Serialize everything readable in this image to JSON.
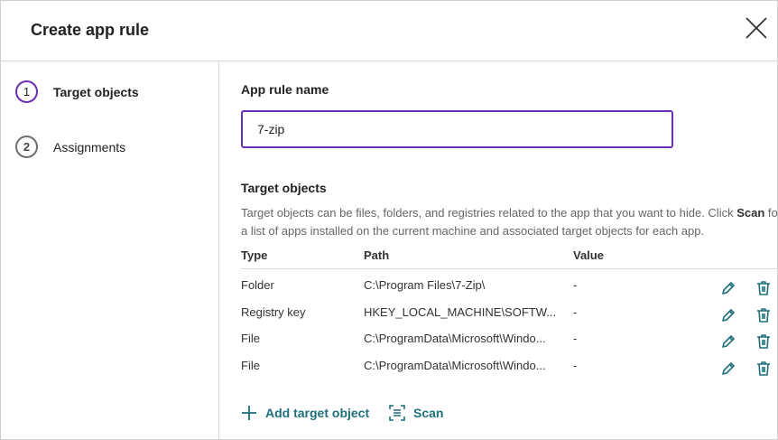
{
  "dialog": {
    "title": "Create app rule"
  },
  "steps": [
    {
      "number": "1",
      "label": "Target objects"
    },
    {
      "number": "2",
      "label": "Assignments"
    }
  ],
  "form": {
    "name_label": "App rule name",
    "name_value": "7-zip",
    "targets_label": "Target objects",
    "description_prefix": "Target objects can be files, folders, and registries related to the app that you want to hide. Click",
    "description_scan": "Scan",
    "description_suffix": "for a list of apps installed on the current machine and associated target objects for each app."
  },
  "table": {
    "columns": [
      "Type",
      "Path",
      "Value"
    ],
    "rows": [
      {
        "type": "Folder",
        "path": "C:\\Program Files\\7-Zip\\",
        "value": "-"
      },
      {
        "type": "Registry key",
        "path": "HKEY_LOCAL_MACHINE\\SOFTW...",
        "value": "-"
      },
      {
        "type": "File",
        "path": "C:\\ProgramData\\Microsoft\\Windo...",
        "value": "-"
      },
      {
        "type": "File",
        "path": "C:\\ProgramData\\Microsoft\\Windo...",
        "value": "-"
      }
    ]
  },
  "actions": {
    "add_label": "Add target object",
    "scan_label": "Scan"
  },
  "colors": {
    "accent": "#6b2fb3",
    "link": "#1f6f7a"
  },
  "icons": [
    "close-icon",
    "edit-icon",
    "trash-icon",
    "plus-icon",
    "scan-icon"
  ]
}
